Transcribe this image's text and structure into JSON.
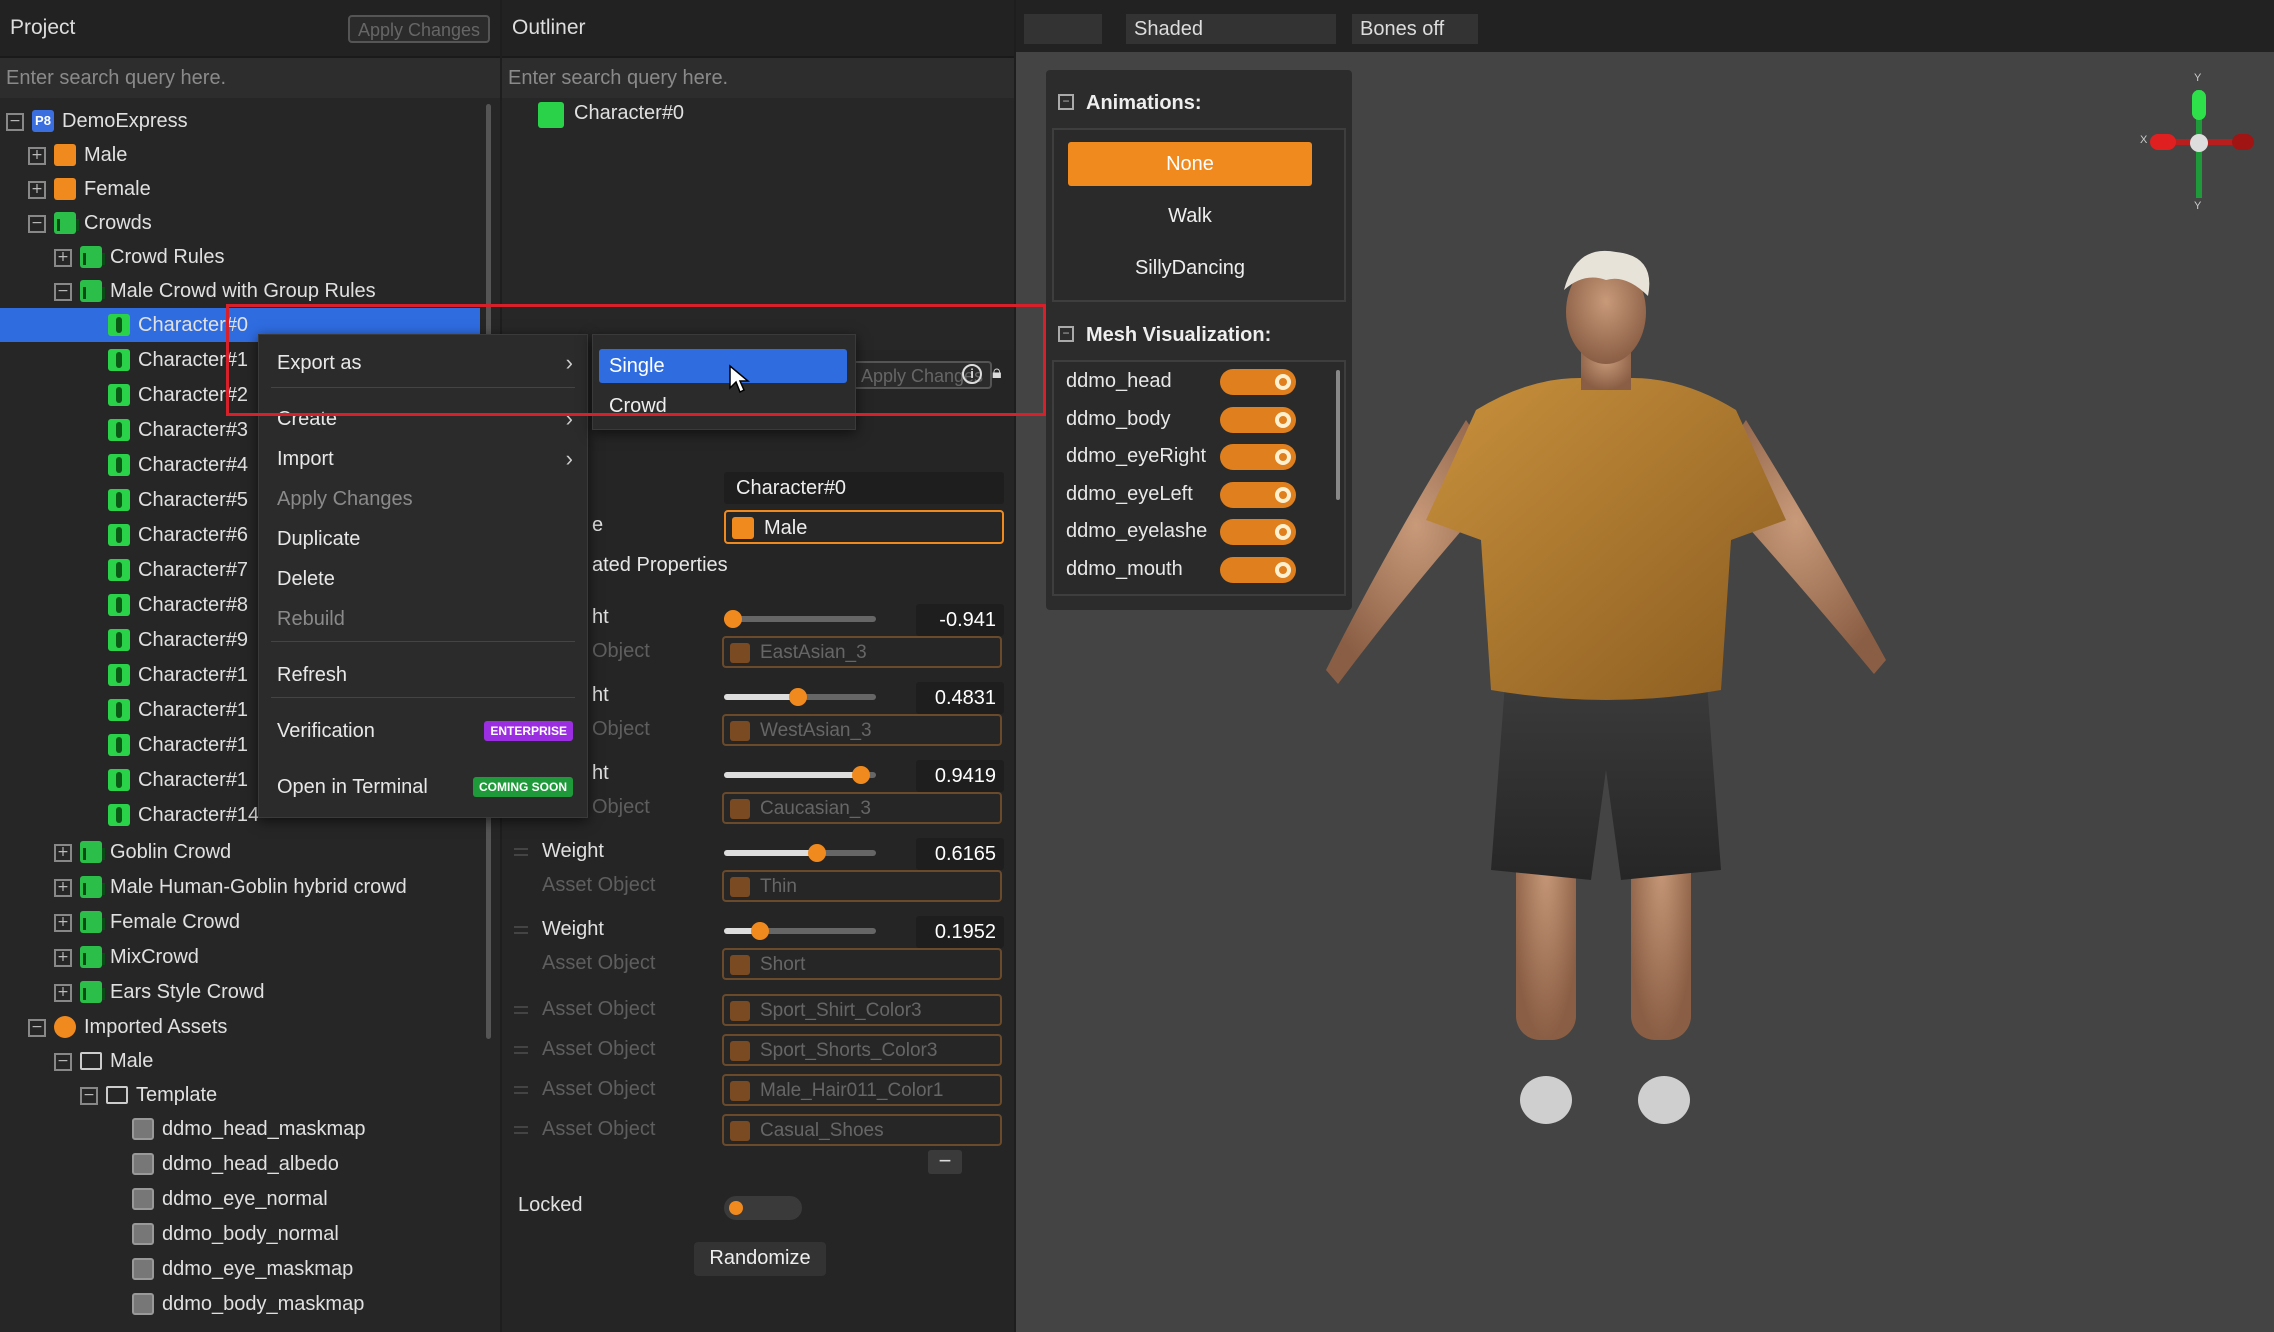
{
  "project": {
    "title": "Project",
    "apply_label": "Apply Changes",
    "search_placeholder": "Enter search query here.",
    "tree": [
      {
        "label": "DemoExpress",
        "icon": "project-icon",
        "icon_text": "P8"
      },
      {
        "label": "Male",
        "icon": "character-template-icon"
      },
      {
        "label": "Female",
        "icon": "character-template-icon"
      },
      {
        "label": "Crowds",
        "icon": "folder-icon"
      },
      {
        "label": "Crowd Rules",
        "icon": "crowd-rules-icon"
      },
      {
        "label": "Male Crowd with Group Rules",
        "icon": "crowd-icon"
      },
      {
        "label": "Character#0",
        "icon": "character-icon"
      },
      {
        "label": "Character#1",
        "icon": "character-icon"
      },
      {
        "label": "Character#2",
        "icon": "character-icon"
      },
      {
        "label": "Character#3",
        "icon": "character-icon"
      },
      {
        "label": "Character#4",
        "icon": "character-icon"
      },
      {
        "label": "Character#5",
        "icon": "character-icon"
      },
      {
        "label": "Character#6",
        "icon": "character-icon"
      },
      {
        "label": "Character#7",
        "icon": "character-icon"
      },
      {
        "label": "Character#8",
        "icon": "character-icon"
      },
      {
        "label": "Character#9",
        "icon": "character-icon"
      },
      {
        "label": "Character#1",
        "icon": "character-icon"
      },
      {
        "label": "Character#1",
        "icon": "character-icon"
      },
      {
        "label": "Character#1",
        "icon": "character-icon"
      },
      {
        "label": "Character#1",
        "icon": "character-icon"
      },
      {
        "label": "Character#14",
        "icon": "character-icon"
      },
      {
        "label": "Goblin Crowd",
        "icon": "crowd-icon"
      },
      {
        "label": "Male Human-Goblin hybrid crowd",
        "icon": "crowd-icon"
      },
      {
        "label": "Female Crowd",
        "icon": "crowd-icon"
      },
      {
        "label": "MixCrowd",
        "icon": "crowd-icon"
      },
      {
        "label": "Ears Style Crowd",
        "icon": "crowd-icon"
      },
      {
        "label": "Imported Assets",
        "icon": "asset-icon"
      },
      {
        "label": "Male",
        "icon": "folder-outline-icon"
      },
      {
        "label": "Template",
        "icon": "folder-outline-icon"
      },
      {
        "label": "ddmo_head_maskmap",
        "icon": "texture-icon"
      },
      {
        "label": "ddmo_head_albedo",
        "icon": "texture-icon"
      },
      {
        "label": "ddmo_eye_normal",
        "icon": "texture-icon"
      },
      {
        "label": "ddmo_body_normal",
        "icon": "texture-icon"
      },
      {
        "label": "ddmo_eye_maskmap",
        "icon": "texture-icon"
      },
      {
        "label": "ddmo_body_maskmap",
        "icon": "texture-icon"
      }
    ]
  },
  "outliner": {
    "title": "Outliner",
    "search_placeholder": "Enter search query here.",
    "item": "Character#0",
    "apply_label": "Apply Changes",
    "name_value": "Character#0",
    "template_label": "e",
    "template_value": "Male",
    "section_label": "ated Properties",
    "weight_label": "Weight",
    "weight_label_partial": "ht",
    "asset_label": "Asset Object",
    "asset_label_partial": "Object",
    "weights": [
      {
        "value": "-0.941",
        "fraction": 0.06,
        "asset": "EastAsian_3"
      },
      {
        "value": "0.4831",
        "fraction": 0.49,
        "asset": "WestAsian_3"
      },
      {
        "value": "0.9419",
        "fraction": 0.9,
        "asset": "Caucasian_3"
      },
      {
        "value": "0.6165",
        "fraction": 0.61,
        "asset": "Thin"
      },
      {
        "value": "0.1952",
        "fraction": 0.24,
        "asset": "Short"
      }
    ],
    "extra_assets": [
      "Sport_Shirt_Color3",
      "Sport_Shorts_Color3",
      "Male_Hair011_Color1",
      "Casual_Shoes"
    ],
    "minus_label": "−",
    "locked_label": "Locked",
    "randomize_label": "Randomize"
  },
  "context_menu": {
    "items": [
      {
        "label": "Export as",
        "submenu": true,
        "enabled": true
      },
      {
        "label": "Create",
        "submenu": true,
        "enabled": true
      },
      {
        "label": "Import",
        "submenu": true,
        "enabled": true
      },
      {
        "label": "Apply Changes",
        "submenu": false,
        "enabled": false
      },
      {
        "label": "Duplicate",
        "submenu": false,
        "enabled": true
      },
      {
        "label": "Delete",
        "submenu": false,
        "enabled": true
      },
      {
        "label": "Rebuild",
        "submenu": false,
        "enabled": false
      },
      {
        "label": "Refresh",
        "submenu": false,
        "enabled": true
      },
      {
        "label": "Verification",
        "submenu": false,
        "enabled": true,
        "badge": "ENTERPRISE"
      },
      {
        "label": "Open in Terminal",
        "submenu": false,
        "enabled": true,
        "badge": "COMING SOON"
      }
    ],
    "submenu": [
      "Single",
      "Crowd"
    ]
  },
  "viewport": {
    "tabs": [
      "",
      "Shaded",
      "Bones off"
    ],
    "gizmo": {
      "x": "X",
      "y": "Y",
      "y2": "Y"
    },
    "animations_title": "Animations:",
    "animations": [
      "None",
      "Walk",
      "SillyDancing"
    ],
    "selected_animation": "None",
    "mesh_title": "Mesh Visualization:",
    "meshes": [
      "ddmo_head",
      "ddmo_body",
      "ddmo_eyeRight",
      "ddmo_eyeLeft",
      "ddmo_eyelashe",
      "ddmo_mouth"
    ]
  },
  "colors": {
    "accent": "#f08a1e",
    "selection": "#2f6ce0",
    "highlight_box": "#d8202a",
    "enterprise": "#9a2ee0",
    "coming_soon": "#1f9a3a"
  }
}
